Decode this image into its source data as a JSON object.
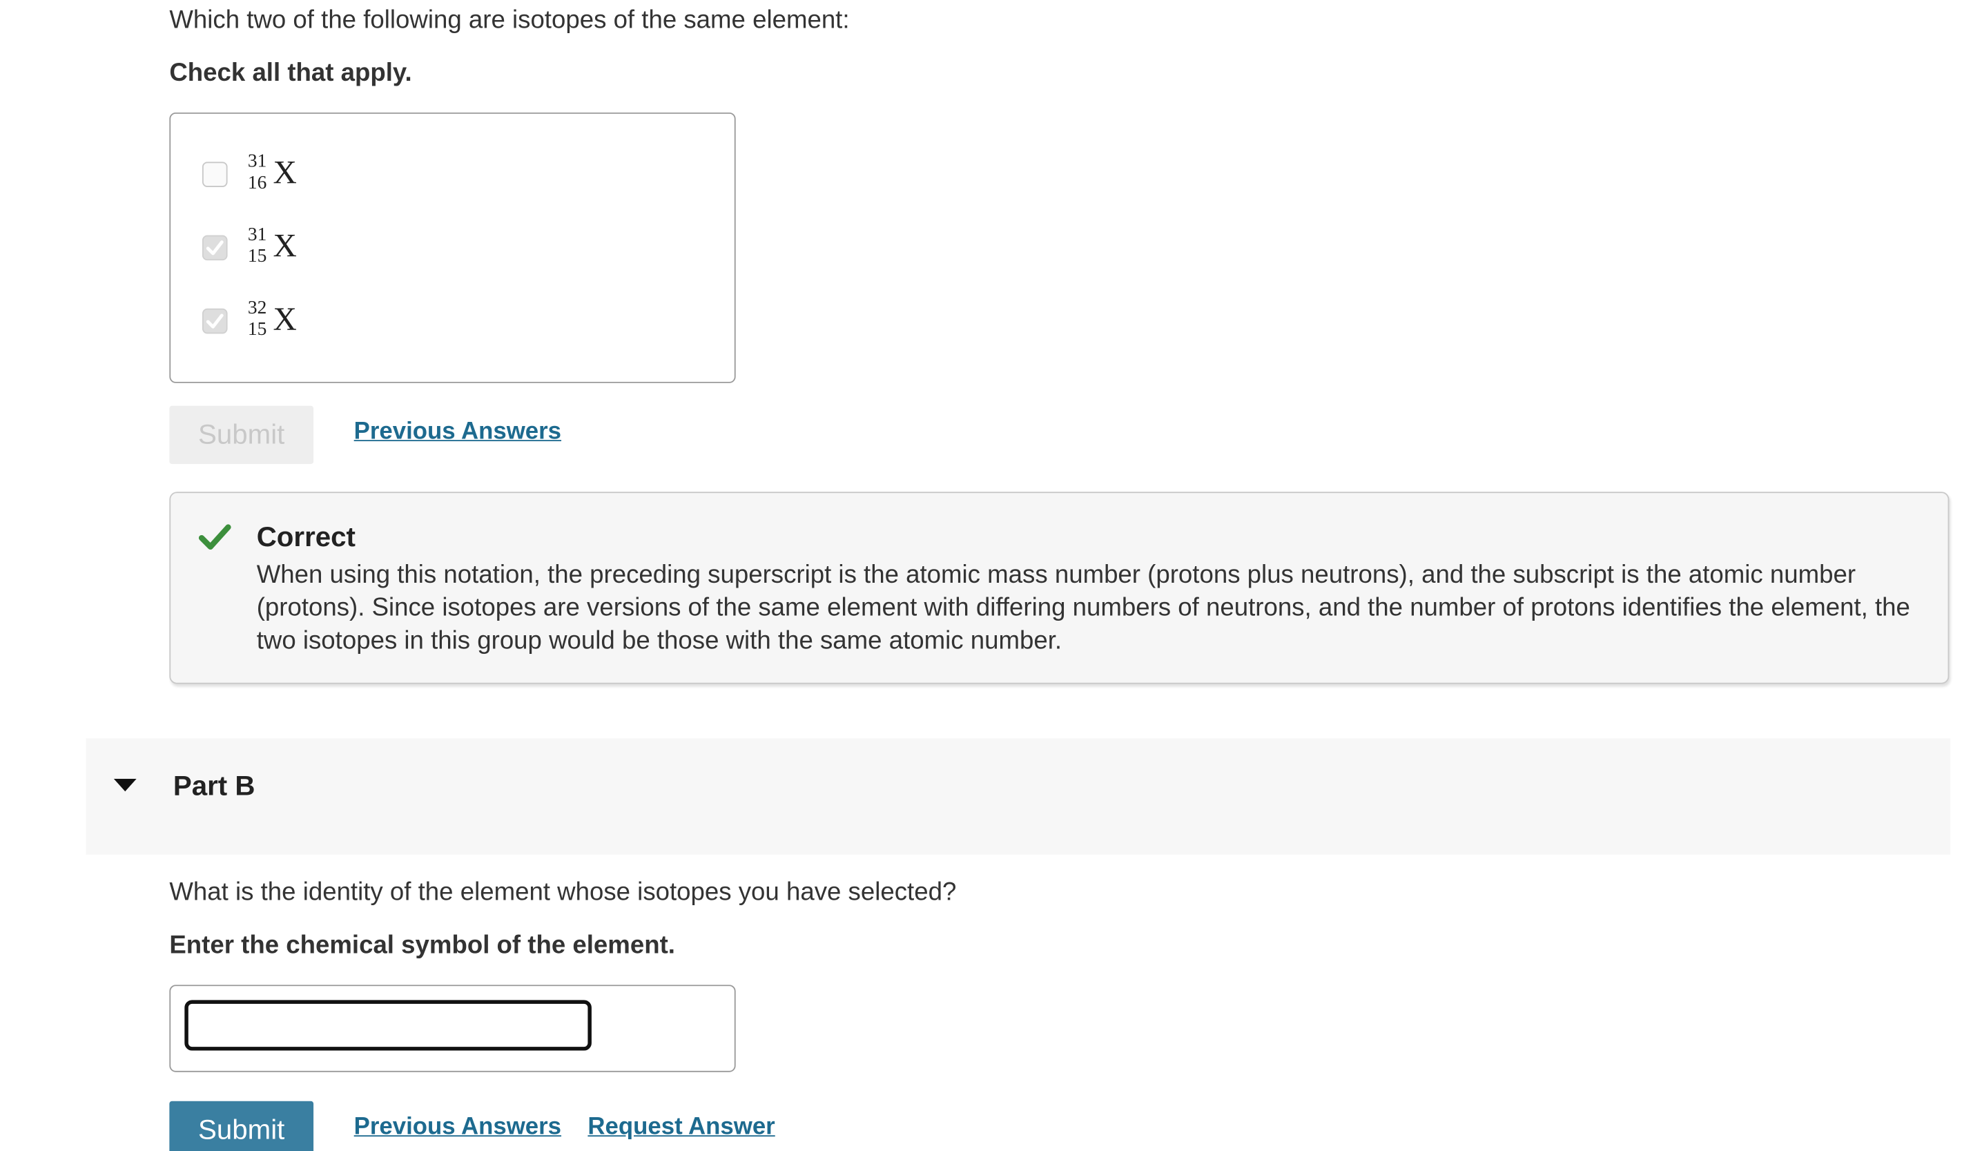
{
  "part_a": {
    "question": "Which two of the following are isotopes of the same element:",
    "instruction": "Check all that apply.",
    "options": [
      {
        "mass": "31",
        "atomic_number": "16",
        "symbol": "X",
        "checked": false
      },
      {
        "mass": "31",
        "atomic_number": "15",
        "symbol": "X",
        "checked": true
      },
      {
        "mass": "32",
        "atomic_number": "15",
        "symbol": "X",
        "checked": true
      }
    ],
    "submit_label": "Submit",
    "previous_answers_label": "Previous Answers",
    "feedback": {
      "title": "Correct",
      "body": "When using this notation, the preceding superscript is the atomic mass number (protons plus neutrons), and the subscript is the atomic number (protons). Since isotopes are versions of the same element with differing numbers of neutrons, and the number of protons identifies the element, the two isotopes in this group would be those with the same atomic number."
    }
  },
  "part_b": {
    "title": "Part B",
    "question": "What is the identity of the element whose isotopes you have selected?",
    "instruction": "Enter the chemical symbol of the element.",
    "answer_value": "",
    "submit_label": "Submit",
    "previous_answers_label": "Previous Answers",
    "request_answer_label": "Request Answer"
  },
  "colors": {
    "link": "#1d6a8f",
    "submit_active": "#3a7fa1",
    "correct_check": "#3c8f3c"
  }
}
